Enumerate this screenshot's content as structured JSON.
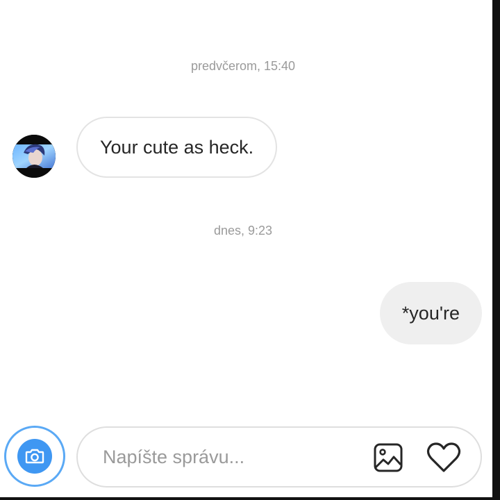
{
  "thread": {
    "messages": [
      {
        "timestamp": "predvčerom, 15:40",
        "direction": "incoming",
        "text": "Your cute as heck."
      },
      {
        "timestamp": "dnes, 9:23",
        "direction": "outgoing",
        "text": "*you're"
      }
    ]
  },
  "composer": {
    "placeholder": "Napíšte správu...",
    "value": "",
    "camera_icon": "camera-icon",
    "gallery_icon": "image-icon",
    "like_icon": "heart-icon"
  },
  "colors": {
    "accent": "#3f97f2",
    "accent_ring": "#5aa9f5",
    "timestamp_text": "#9a9a9a",
    "outgoing_bubble": "#efefef",
    "incoming_border": "#e3e3e3",
    "text": "#262626"
  }
}
